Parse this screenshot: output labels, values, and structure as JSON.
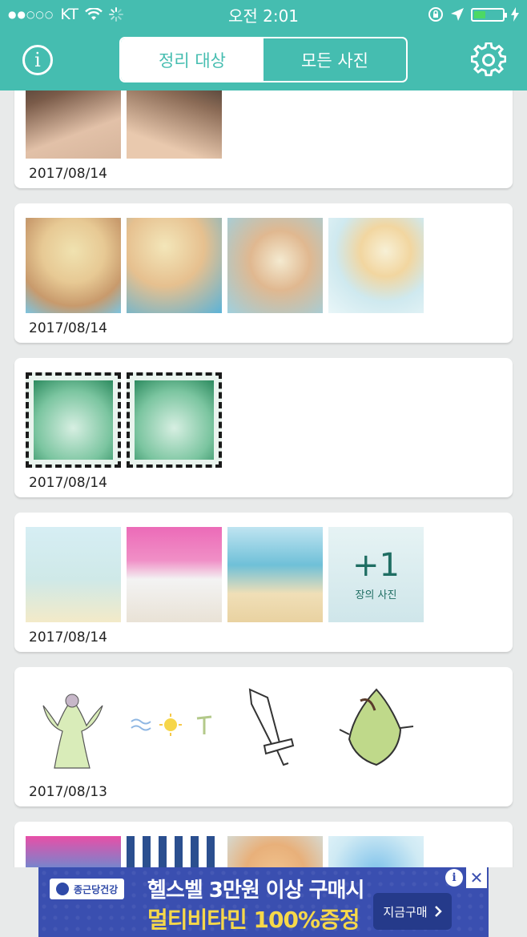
{
  "status_bar": {
    "signal": "●●○○○",
    "carrier": "KT",
    "time": "오전 2:01",
    "icons": [
      "wifi-icon",
      "loading-icon",
      "rotation-lock-icon",
      "location-arrow-icon",
      "battery-icon",
      "charging-icon"
    ],
    "battery_level": 0.4
  },
  "nav": {
    "info_icon": "info-icon",
    "settings_icon": "gear-icon",
    "tabs": [
      {
        "label": "정리 대상",
        "active": true
      },
      {
        "label": "모든 사진",
        "active": false
      }
    ]
  },
  "cards": [
    {
      "date": "2017/08/14"
    },
    {
      "date": "2017/08/14"
    },
    {
      "date": "2017/08/14"
    },
    {
      "date": "2017/08/14",
      "more_count": "+1",
      "more_label": "장의 사진"
    },
    {
      "date": "2017/08/13"
    },
    {
      "date": ""
    }
  ],
  "ad": {
    "brand": "종근당건강",
    "line1": "헬스벨 3만원 이상 구매시",
    "line2": "멀티비타민 100%증정",
    "cta": "지금구매",
    "info_glyph": "i",
    "close_glyph": "✕"
  },
  "colors": {
    "header": "#45bdb0",
    "background": "#e8eaea",
    "ad_background": "#3a4fb0",
    "ad_highlight": "#f6d84a"
  }
}
